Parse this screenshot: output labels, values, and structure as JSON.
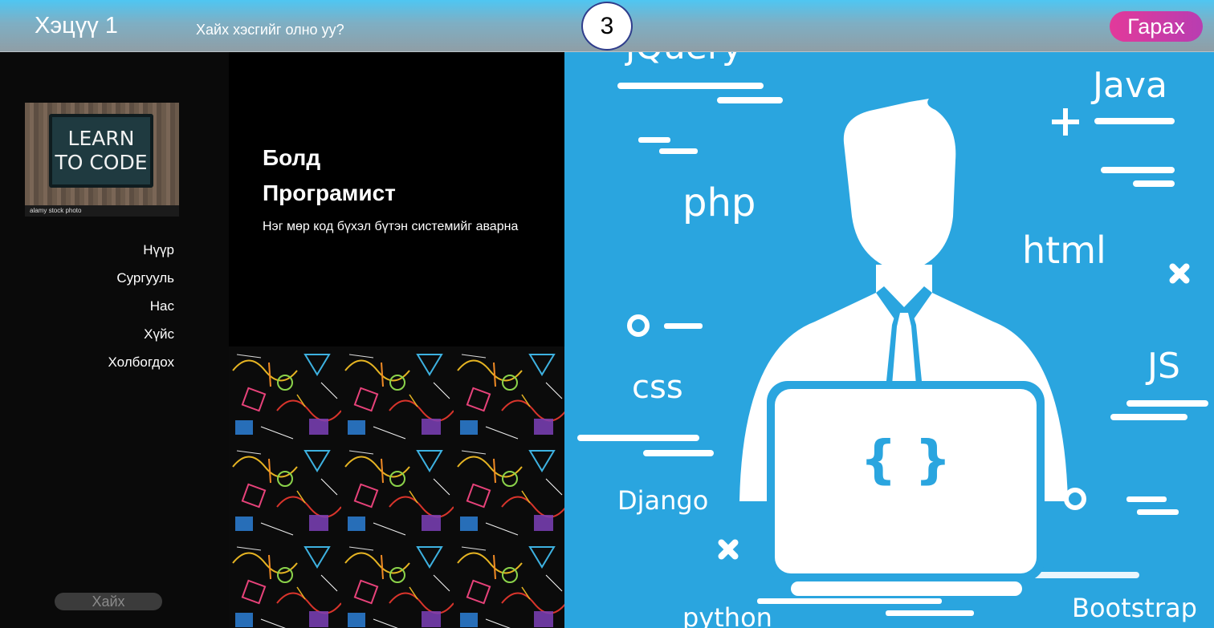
{
  "header": {
    "title": "Хэцүү 1",
    "prompt": "Хайх хэсгийг олно уу?",
    "counter": "3",
    "logout_label": "Гарах"
  },
  "sidebar": {
    "logo": {
      "line1": "LEARN",
      "line2": "TO CODE",
      "caption": "alamy stock photo"
    },
    "nav": [
      {
        "label": "Нүүр"
      },
      {
        "label": "Сургууль"
      },
      {
        "label": "Нас"
      },
      {
        "label": "Хүйс"
      },
      {
        "label": "Холбогдох"
      }
    ],
    "search_label": "Хайх"
  },
  "profile": {
    "name": "Болд",
    "role": "Програмист",
    "motto": "Нэг мөр код бүхэл бүтэн системийг аварна"
  },
  "hero": {
    "code_symbol": "{ }",
    "tech": [
      "jQuery",
      "Java",
      "php",
      "html",
      "css",
      "JS",
      "Django",
      "python",
      "Bootstrap"
    ]
  },
  "colors": {
    "hero_bg": "#2aa5df",
    "logout_gradient_start": "#e23a9a",
    "logout_gradient_end": "#b83db1",
    "header_top": "#4fc6f2"
  }
}
